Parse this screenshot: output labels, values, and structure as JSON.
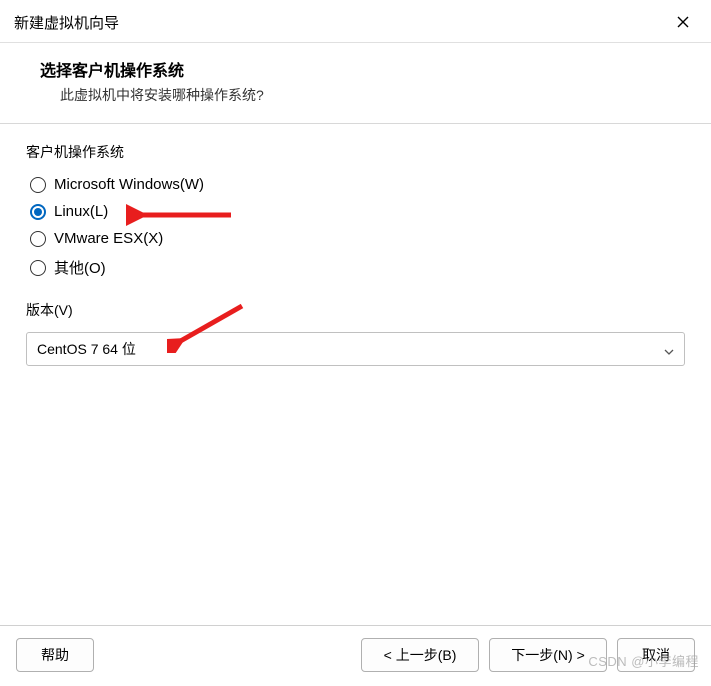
{
  "titlebar": {
    "title": "新建虚拟机向导"
  },
  "header": {
    "title": "选择客户机操作系统",
    "subtitle": "此虚拟机中将安装哪种操作系统?"
  },
  "os_group": {
    "label": "客户机操作系统",
    "options": [
      {
        "label": "Microsoft Windows(W)",
        "checked": false
      },
      {
        "label": "Linux(L)",
        "checked": true
      },
      {
        "label": "VMware ESX(X)",
        "checked": false
      },
      {
        "label": "其他(O)",
        "checked": false
      }
    ]
  },
  "version": {
    "label": "版本(V)",
    "selected": "CentOS 7 64 位"
  },
  "footer": {
    "help": "帮助",
    "back": "< 上一步(B)",
    "next": "下一步(N) >",
    "cancel": "取消"
  },
  "watermark": "CSDN @小李编程",
  "annotations": {
    "arrows": [
      "linux-radio",
      "version-select",
      "next-button"
    ]
  }
}
